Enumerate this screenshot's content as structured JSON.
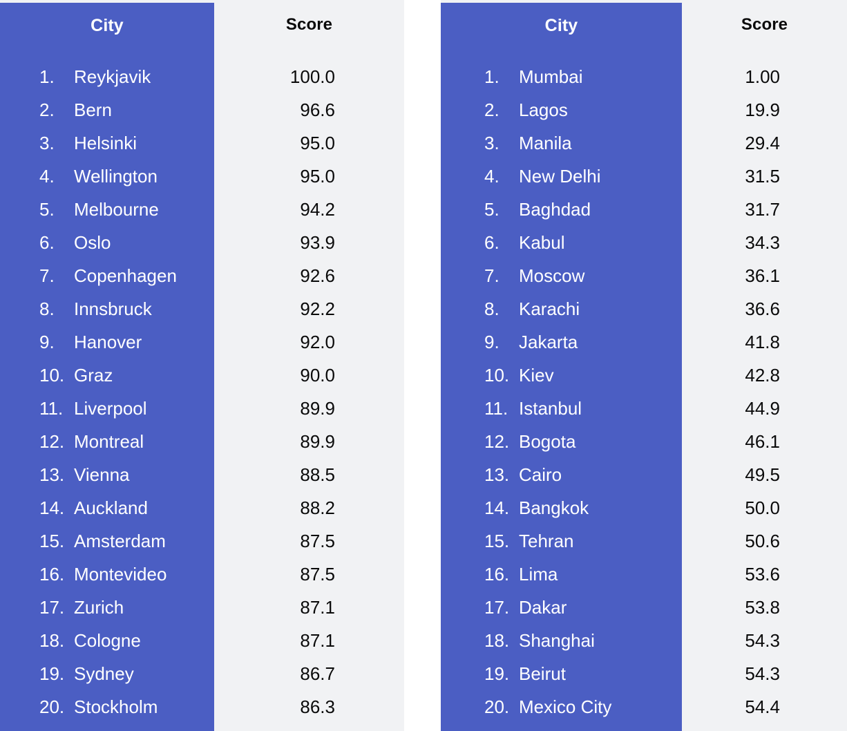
{
  "theme": {
    "panel_blue": "#4b5ec3",
    "panel_gray": "#f1f2f4",
    "page_background": "#ffffff",
    "city_text_color": "#ffffff",
    "score_text_color": "#0a0a0a"
  },
  "tables": [
    {
      "id": "most-livable-cities",
      "headers": {
        "city": "City",
        "score": "Score"
      },
      "rows": [
        {
          "rank": "1.",
          "city": "Reykjavik",
          "score": "100.0"
        },
        {
          "rank": "2.",
          "city": "Bern",
          "score": "96.6"
        },
        {
          "rank": "3.",
          "city": "Helsinki",
          "score": "95.0"
        },
        {
          "rank": "4.",
          "city": "Wellington",
          "score": "95.0"
        },
        {
          "rank": "5.",
          "city": "Melbourne",
          "score": "94.2"
        },
        {
          "rank": "6.",
          "city": "Oslo",
          "score": "93.9"
        },
        {
          "rank": "7.",
          "city": "Copenhagen",
          "score": "92.6"
        },
        {
          "rank": "8.",
          "city": "Innsbruck",
          "score": "92.2"
        },
        {
          "rank": "9.",
          "city": "Hanover",
          "score": "92.0"
        },
        {
          "rank": "10.",
          "city": "Graz",
          "score": "90.0"
        },
        {
          "rank": "11.",
          "city": "Liverpool",
          "score": "89.9"
        },
        {
          "rank": "12.",
          "city": "Montreal",
          "score": "89.9"
        },
        {
          "rank": "13.",
          "city": "Vienna",
          "score": "88.5"
        },
        {
          "rank": "14.",
          "city": "Auckland",
          "score": "88.2"
        },
        {
          "rank": "15.",
          "city": "Amsterdam",
          "score": "87.5"
        },
        {
          "rank": "16.",
          "city": "Montevideo",
          "score": "87.5"
        },
        {
          "rank": "17.",
          "city": "Zurich",
          "score": "87.1"
        },
        {
          "rank": "18.",
          "city": "Cologne",
          "score": "87.1"
        },
        {
          "rank": "19.",
          "city": "Sydney",
          "score": "86.7"
        },
        {
          "rank": "20.",
          "city": "Stockholm",
          "score": "86.3"
        }
      ]
    },
    {
      "id": "least-livable-cities",
      "headers": {
        "city": "City",
        "score": "Score"
      },
      "rows": [
        {
          "rank": "1.",
          "city": "Mumbai",
          "score": "1.00"
        },
        {
          "rank": "2.",
          "city": "Lagos",
          "score": "19.9"
        },
        {
          "rank": "3.",
          "city": "Manila",
          "score": "29.4"
        },
        {
          "rank": "4.",
          "city": "New Delhi",
          "score": "31.5"
        },
        {
          "rank": "5.",
          "city": "Baghdad",
          "score": "31.7"
        },
        {
          "rank": "6.",
          "city": "Kabul",
          "score": "34.3"
        },
        {
          "rank": "7.",
          "city": "Moscow",
          "score": "36.1"
        },
        {
          "rank": "8.",
          "city": "Karachi",
          "score": "36.6"
        },
        {
          "rank": "9.",
          "city": "Jakarta",
          "score": "41.8"
        },
        {
          "rank": "10.",
          "city": "Kiev",
          "score": "42.8"
        },
        {
          "rank": "11.",
          "city": "Istanbul",
          "score": "44.9"
        },
        {
          "rank": "12.",
          "city": "Bogota",
          "score": "46.1"
        },
        {
          "rank": "13.",
          "city": "Cairo",
          "score": "49.5"
        },
        {
          "rank": "14.",
          "city": "Bangkok",
          "score": "50.0"
        },
        {
          "rank": "15.",
          "city": "Tehran",
          "score": "50.6"
        },
        {
          "rank": "16.",
          "city": "Lima",
          "score": "53.6"
        },
        {
          "rank": "17.",
          "city": "Dakar",
          "score": "53.8"
        },
        {
          "rank": "18.",
          "city": "Shanghai",
          "score": "54.3"
        },
        {
          "rank": "19.",
          "city": "Beirut",
          "score": "54.3"
        },
        {
          "rank": "20.",
          "city": "Mexico City",
          "score": "54.4"
        }
      ]
    }
  ]
}
